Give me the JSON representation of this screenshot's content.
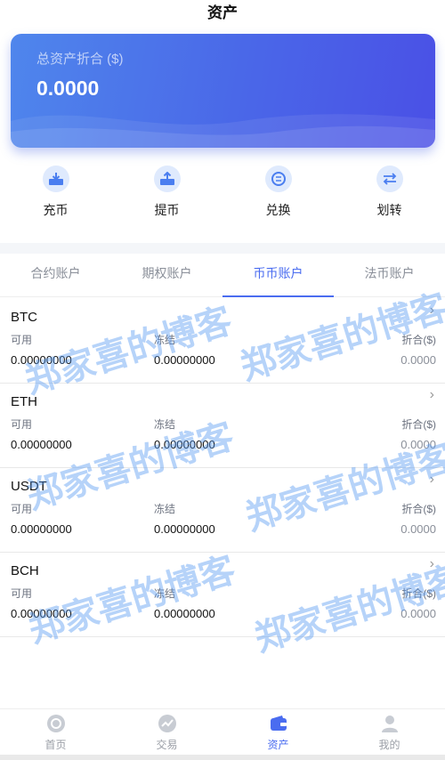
{
  "header": {
    "title": "资产"
  },
  "summary": {
    "label": "总资产折合 ($)",
    "value": "0.0000"
  },
  "actions": [
    {
      "label": "充币",
      "icon": "deposit-icon"
    },
    {
      "label": "提币",
      "icon": "withdraw-icon"
    },
    {
      "label": "兑换",
      "icon": "exchange-icon"
    },
    {
      "label": "划转",
      "icon": "transfer-icon"
    }
  ],
  "tabs": [
    {
      "label": "合约账户",
      "active": false
    },
    {
      "label": "期权账户",
      "active": false
    },
    {
      "label": "币币账户",
      "active": true
    },
    {
      "label": "法币账户",
      "active": false
    }
  ],
  "columns": {
    "available": "可用",
    "frozen": "冻结",
    "equivalent": "折合($)"
  },
  "assets": [
    {
      "symbol": "BTC",
      "available": "0.00000000",
      "frozen": "0.00000000",
      "equivalent": "0.0000"
    },
    {
      "symbol": "ETH",
      "available": "0.00000000",
      "frozen": "0.00000000",
      "equivalent": "0.0000"
    },
    {
      "symbol": "USDT",
      "available": "0.00000000",
      "frozen": "0.00000000",
      "equivalent": "0.0000"
    },
    {
      "symbol": "BCH",
      "available": "0.00000000",
      "frozen": "0.00000000",
      "equivalent": "0.0000"
    }
  ],
  "watermark": "郑家喜的博客",
  "tabbar": [
    {
      "label": "首页",
      "icon": "home-icon",
      "active": false
    },
    {
      "label": "交易",
      "icon": "trade-icon",
      "active": false
    },
    {
      "label": "资产",
      "icon": "wallet-icon",
      "active": true
    },
    {
      "label": "我的",
      "icon": "user-icon",
      "active": false
    }
  ],
  "colors": {
    "accent": "#4a6cf0",
    "card_start": "#4f86ec",
    "card_end": "#4a50e6",
    "icon_bg": "#dfeafd"
  }
}
